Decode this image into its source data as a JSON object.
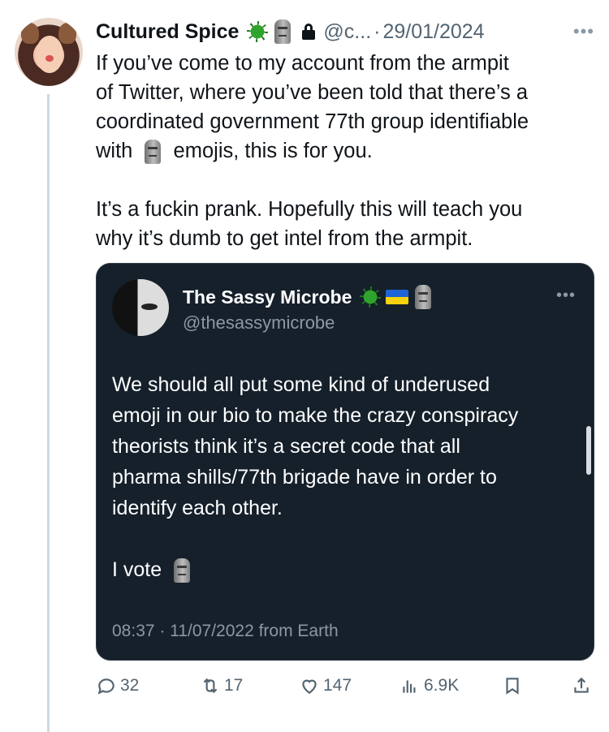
{
  "tweet": {
    "author_name": "Cultured Spice",
    "author_handle": "@c...",
    "separator": "·",
    "date": "29/01/2024",
    "lines": [
      "If you’ve come to my account from the armpit",
      "of Twitter, where you’ve been told that there’s a",
      "coordinated government 77th group identifiable",
      "emojis, this is for you.",
      "It’s a fuckin prank. Hopefully this will teach you",
      "why it’s dumb to get intel from the armpit."
    ],
    "with_word": "with"
  },
  "quote": {
    "author_name": "The Sassy Microbe",
    "author_handle": "@thesassymicrobe",
    "lines": [
      "We should all put some kind of underused",
      "emoji in our bio to make the crazy conspiracy",
      "theorists think it’s a secret code that all",
      "pharma shills/77th brigade have in order to",
      "identify each other."
    ],
    "vote_text": "I vote",
    "meta": "08:37 · 11/07/2022 from Earth"
  },
  "actions": {
    "replies": "32",
    "retweets": "17",
    "likes": "147",
    "views": "6.9K"
  },
  "icons": [
    "virus-emoji",
    "moai-emoji",
    "lock-icon",
    "ukraine-flag-emoji",
    "reply-icon",
    "retweet-icon",
    "like-icon",
    "views-icon",
    "bookmark-icon",
    "share-icon",
    "more-icon"
  ],
  "colors": {
    "quote_bg": "#15202b",
    "text": "#0f1419",
    "muted": "#536471"
  }
}
